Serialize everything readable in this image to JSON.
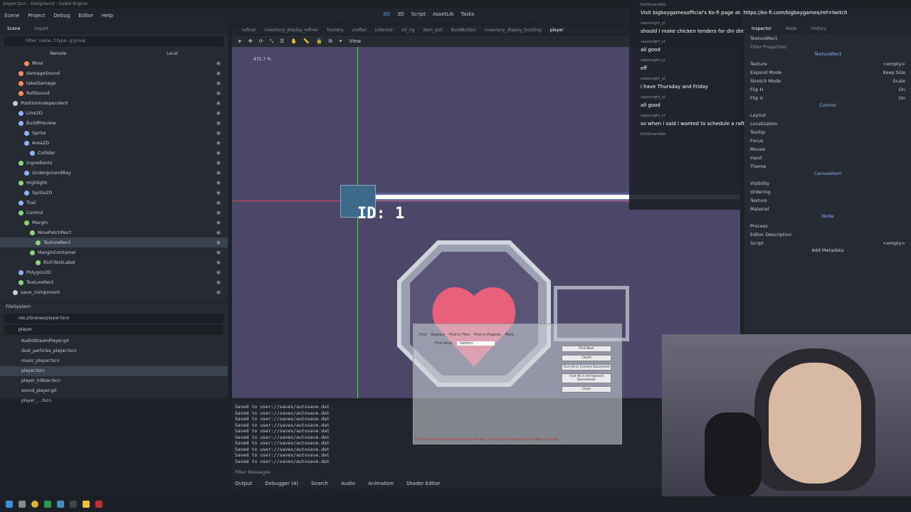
{
  "title": "player.tscn - Starground - Godot Engine",
  "menu": [
    "Scene",
    "Project",
    "Debug",
    "Editor",
    "Help"
  ],
  "workspaces": [
    "2D",
    "3D",
    "Script",
    "AssetLib",
    "Tasks"
  ],
  "scene_panel": {
    "tabs": [
      "Scene",
      "Import"
    ],
    "filter_placeholder": "Filter: name, t:type, g:group",
    "remote_label": "Remote",
    "local_label": "Local",
    "nodes": [
      {
        "name": "Mine",
        "indent": 3,
        "color": "#ff8c5a"
      },
      {
        "name": "damageSound",
        "indent": 2,
        "color": "#ff8c5a"
      },
      {
        "name": "takeDamage",
        "indent": 2,
        "color": "#ff8c5a"
      },
      {
        "name": "RollSound",
        "indent": 2,
        "color": "#ff8c5a"
      },
      {
        "name": "PositionIndependent",
        "indent": 1,
        "color": "#c8ccd4"
      },
      {
        "name": "Line2D",
        "indent": 2,
        "color": "#8db0ff"
      },
      {
        "name": "BuildPreview",
        "indent": 2,
        "color": "#8db0ff"
      },
      {
        "name": "Sprite",
        "indent": 3,
        "color": "#8db0ff"
      },
      {
        "name": "Area2D",
        "indent": 3,
        "color": "#8db0ff"
      },
      {
        "name": "Collider",
        "indent": 4,
        "color": "#8db0ff"
      },
      {
        "name": "Ingredients",
        "indent": 2,
        "color": "#8bd67a"
      },
      {
        "name": "UndergroundRay",
        "indent": 3,
        "color": "#8db0ff"
      },
      {
        "name": "Highlight",
        "indent": 2,
        "color": "#8bd67a"
      },
      {
        "name": "Sprite2D",
        "indent": 3,
        "color": "#8db0ff"
      },
      {
        "name": "Trail",
        "indent": 2,
        "color": "#8db0ff"
      },
      {
        "name": "Control",
        "indent": 2,
        "color": "#8bd67a"
      },
      {
        "name": "Margin",
        "indent": 3,
        "color": "#8bd67a"
      },
      {
        "name": "NinePatchRect",
        "indent": 4,
        "color": "#8bd67a"
      },
      {
        "name": "TextureRect",
        "indent": 5,
        "color": "#8bd67a"
      },
      {
        "name": "MarginContainer",
        "indent": 4,
        "color": "#8bd67a"
      },
      {
        "name": "RichTextLabel",
        "indent": 5,
        "color": "#8bd67a"
      },
      {
        "name": "Polygon2D",
        "indent": 2,
        "color": "#8db0ff"
      },
      {
        "name": "TextureRect",
        "indent": 2,
        "color": "#8bd67a"
      },
      {
        "name": "save_component",
        "indent": 1,
        "color": "#c8ccd4"
      }
    ],
    "selected_index": 18
  },
  "filesystem": {
    "title": "FileSystem",
    "path": "res://Scenes/player.tscn",
    "search": "player",
    "files": [
      "AudioStreamPlayer.gd",
      "dust_particles_player.tscn",
      "music_player.tscn",
      "player.tscn",
      "player_hitbox.tscn",
      "sound_player.gd",
      "player_....tscn"
    ],
    "selected_index": 3
  },
  "editor_tabs": [
    "refiner",
    "inventory_display_refiner",
    "foundry",
    "crafter",
    "collector",
    "oil_rig",
    "item_slot",
    "BuildButton",
    "inventory_display_building",
    "player"
  ],
  "editor_tab_active": 9,
  "toolbar": {
    "view_label": "View"
  },
  "viewport": {
    "zoom": "475.7 %",
    "id_text": "ID: 1"
  },
  "chat": {
    "messages": [
      {
        "user": "KofiStreamBot",
        "text": "Visit bigboygamesofficial's Ko-fi page at: https://ko-fi.com/bigboygames/ref=twitch"
      },
      {
        "user": "seazonight_yt",
        "text": "should I make chicken tenders for din din?"
      },
      {
        "user": "seazonight_yt",
        "text": "all good"
      },
      {
        "user": "seazonight_yt",
        "text": "off"
      },
      {
        "user": "seazonight_yt",
        "text": "i have Thursday and Friday"
      },
      {
        "user": "seazonight_yt",
        "text": "all good"
      },
      {
        "user": "seazonight_yt",
        "text": "so when i said i wanted to schedule a raft stream i ment more of when i have days off"
      },
      {
        "user": "KofiStreamBot",
        "text": ""
      }
    ]
  },
  "inspector": {
    "tabs": [
      "Inspector",
      "Node",
      "History"
    ],
    "node_name": "TextureRect",
    "filter": "Filter Properties",
    "class_header": "TextureRect",
    "props": [
      {
        "k": "Texture",
        "v": "<empty>"
      },
      {
        "k": "Expand Mode",
        "v": "Keep Size"
      },
      {
        "k": "Stretch Mode",
        "v": "Scale"
      },
      {
        "k": "Flip H",
        "v": "On"
      },
      {
        "k": "Flip V",
        "v": "On"
      }
    ],
    "control_header": "Control",
    "control_sections": [
      "Layout",
      "Localization",
      "Tooltip",
      "Focus",
      "Mouse",
      "Input",
      "Theme"
    ],
    "canvas_header": "CanvasItem",
    "canvas_sections": [
      "Visibility",
      "Ordering",
      "Texture",
      "Material"
    ],
    "node_header": "Node",
    "node_sections": [
      "Process",
      "Editor Description"
    ],
    "script_label": "Script",
    "script_value": "<empty>",
    "add_metadata": "Add Metadata"
  },
  "output": {
    "lines": [
      "Saved to user://saves/autosave.dat",
      "Saved to user://saves/autosave.dat",
      "Saved to user://saves/autosave.dat",
      "Saved to user://saves/autosave.dat",
      "Saved to user://saves/autosave.dat",
      "Saved to user://saves/autosave.dat",
      "Saved to user://saves/autosave.dat",
      "Saved to user://saves/autosave.dat",
      "Saved to user://saves/autosave.dat",
      "Saved to user://saves/autosave.dat"
    ],
    "filter": "Filter Messages",
    "tabs": [
      "Output",
      "Debugger (4)",
      "Search",
      "Audio",
      "Animation",
      "Shader Editor"
    ]
  },
  "find_dialog": {
    "tabs": [
      "Find",
      "Replace",
      "Find in Files",
      "Find in Projects",
      "Mark"
    ],
    "find_label": "Find what:",
    "find_value": "battery",
    "buttons": [
      "Find Next",
      "Count",
      "Find All in Current Document",
      "Find All in All Opened Documents",
      "Close"
    ],
    "status": "Find: Found the 1st occurrence from the top. The end of the document has been reached."
  }
}
